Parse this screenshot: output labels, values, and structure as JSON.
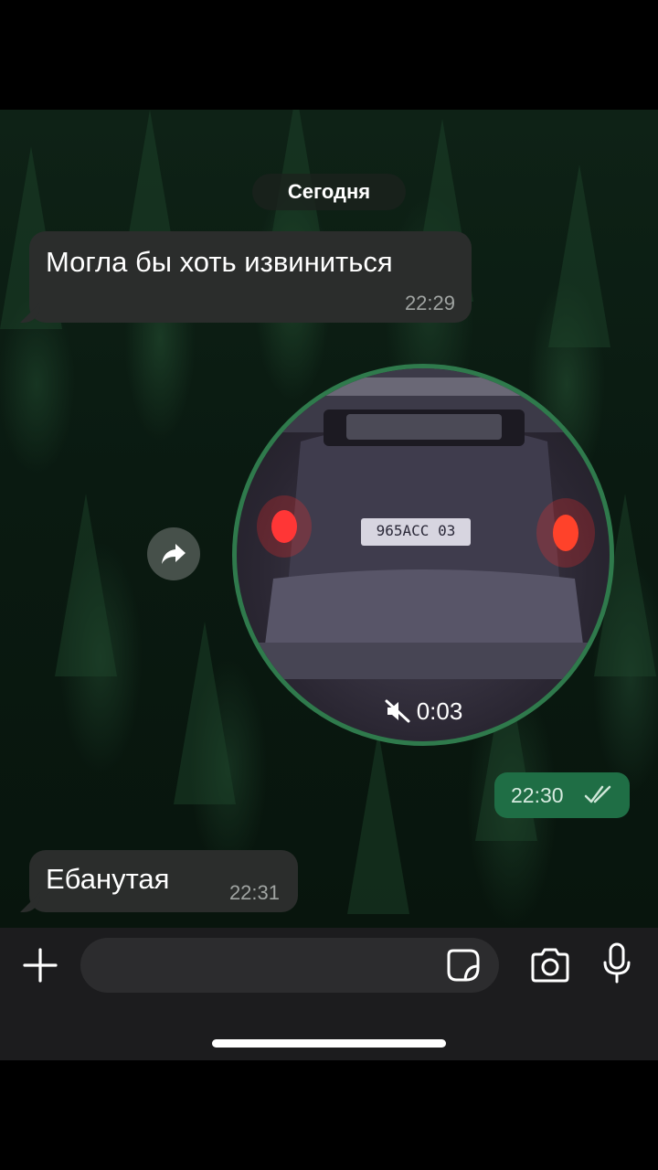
{
  "date_separator": "Сегодня",
  "messages": [
    {
      "direction": "incoming",
      "text": "Могла бы хоть извиниться",
      "time": "22:29"
    },
    {
      "direction": "outgoing",
      "type": "video-note",
      "duration": "0:03",
      "muted": true,
      "time": "22:30",
      "status": "read"
    },
    {
      "direction": "incoming",
      "text": "Ебанутая",
      "time": "22:31"
    }
  ],
  "video": {
    "plate_text": "965АСС 03"
  },
  "composer": {
    "placeholder": ""
  },
  "icons": {
    "attach": "plus-icon",
    "sticker": "sticker-icon",
    "camera": "camera-icon",
    "voice": "microphone-icon",
    "forward": "forward-icon",
    "muted": "speaker-muted-icon",
    "read_receipt": "double-check-icon"
  },
  "colors": {
    "incoming_bubble": "#2b2d2c",
    "outgoing_bubble": "#1f6e45",
    "video_ring": "#2f7a4c",
    "bar": "#1c1c1e"
  }
}
